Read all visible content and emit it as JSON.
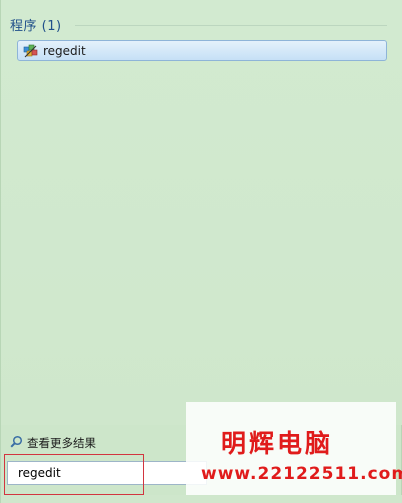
{
  "section": {
    "title": "程序 (1)"
  },
  "results": [
    {
      "label": "regedit",
      "icon": "regedit-icon"
    }
  ],
  "more_results": {
    "label": "查看更多结果",
    "icon": "search-icon"
  },
  "search": {
    "value": "regedit"
  },
  "watermark": {
    "title": "明辉电脑",
    "url": "www.22122511.com"
  },
  "colors": {
    "panel_bg": "#cde6ca",
    "header_text": "#1f4f8a",
    "selection_border": "#8eb4d8",
    "highlight_red": "#d2353f",
    "watermark_red": "#e01b1b"
  }
}
